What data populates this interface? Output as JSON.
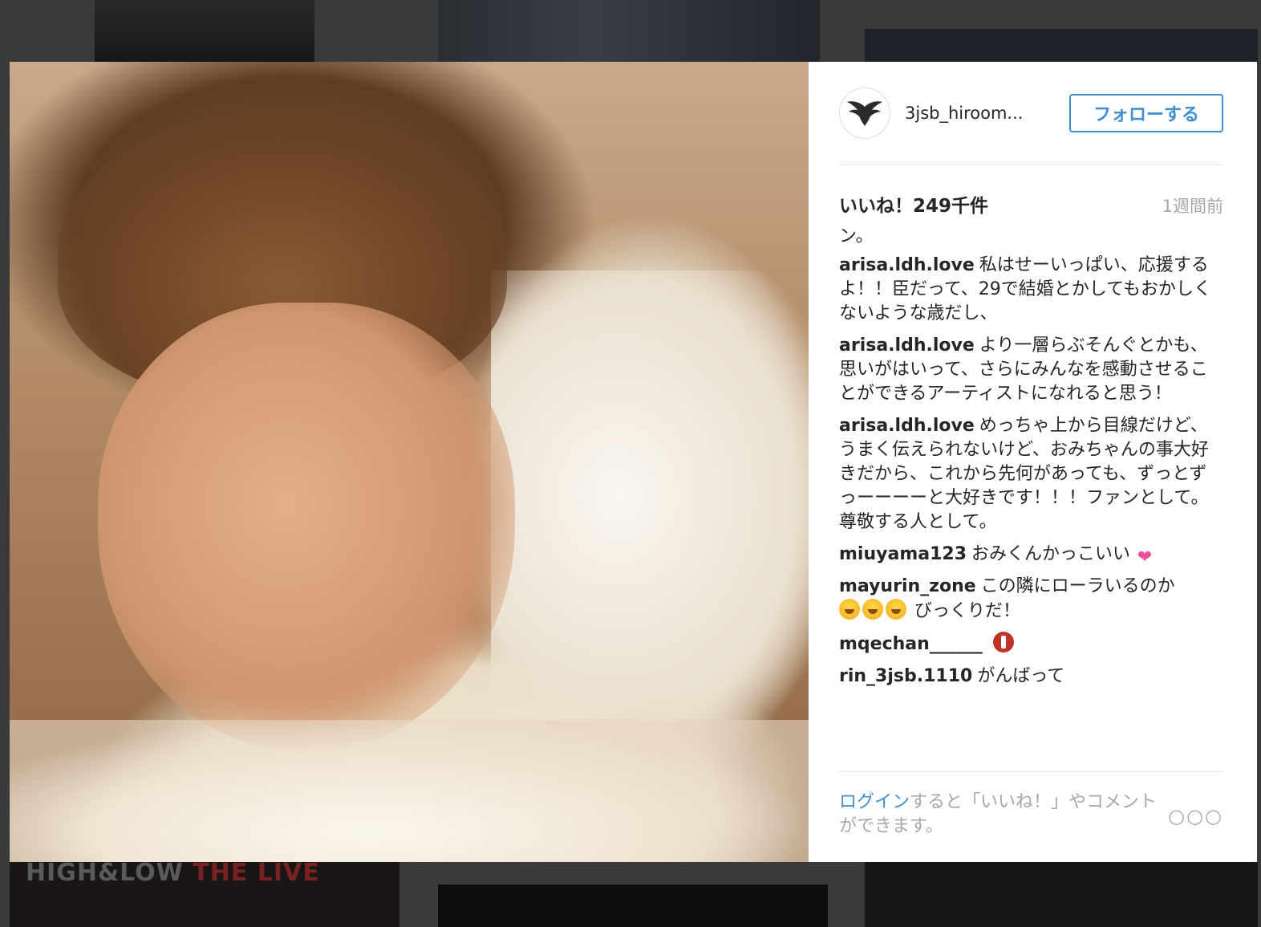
{
  "background": {
    "thumb_text": [
      "HIGH&LOW",
      " THE LIVE"
    ]
  },
  "post": {
    "username": "3jsb_hiroom...",
    "follow_label": "フォローする",
    "likes": "いいね！249千件",
    "time": "1週間前",
    "caption_fragment": "ン。",
    "comments": [
      {
        "user": "arisa.ldh.love",
        "text": "私はせーいっぱい、応援するよ！！臣だって、29で結婚とかしてもおかしくないような歳だし、"
      },
      {
        "user": "arisa.ldh.love",
        "text": "より一層らぶそんぐとかも、思いがはいって、さらにみんなを感動させることができるアーティストになれると思う！"
      },
      {
        "user": "arisa.ldh.love",
        "text": "めっちゃ上から目線だけど、うまく伝えられないけど、おみちゃんの事大好きだから、これから先何があっても、ずっとずっーーーーと大好きです！！！ファンとして。尊敬する人として。"
      },
      {
        "user": "miuyama123",
        "text": "おみくんかっこいい"
      },
      {
        "user": "mayurin_zone",
        "text": "この隣にローラいるのか",
        "text2": "びっくりだ！"
      },
      {
        "user": "mqechan______",
        "text": ""
      },
      {
        "user": "rin_3jsb.1110",
        "text": "がんばって"
      }
    ],
    "footer": {
      "login_link": "ログイン",
      "login_text": "すると「いいね！」やコメントができます。",
      "more_label": "○○○"
    },
    "icons": {
      "avatar": "eagle-logo-icon",
      "heart": "sparkling-heart-emoji",
      "cry": "loudly-crying-face-emoji",
      "noentry": "no-entry-emoji"
    },
    "colors": {
      "link": "#3f8fd2",
      "muted": "#a5a7aa",
      "text": "#262626"
    }
  }
}
